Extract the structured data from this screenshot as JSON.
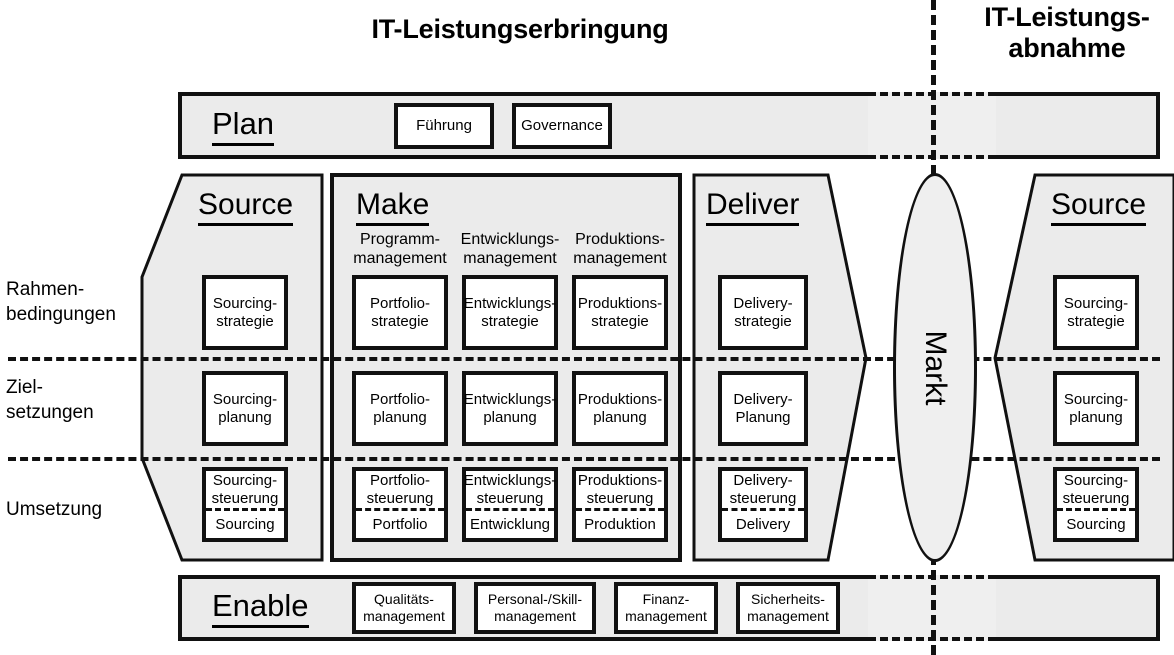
{
  "titles": {
    "left": "IT-Leistungserbringung",
    "right": "IT-Leistungs-\nabnahme"
  },
  "row_labels": [
    "Rahmen-\nbedingungen",
    "Ziel-\nsetzungen",
    "Umsetzung"
  ],
  "plan": {
    "title": "Plan",
    "boxes": [
      "Führung",
      "Governance"
    ]
  },
  "enable": {
    "title": "Enable",
    "boxes": [
      "Qualitäts-\nmanagement",
      "Personal-/Skill-\nmanagement",
      "Finanz-\nmanagement",
      "Sicherheits-\nmanagement"
    ]
  },
  "source_left": {
    "title": "Source",
    "boxes": [
      {
        "top": "Sourcing-\nstrategie",
        "bottom": null
      },
      {
        "top": "Sourcing-\nplanung",
        "bottom": null
      },
      {
        "top": "Sourcing-\nsteuerung",
        "bottom": "Sourcing"
      }
    ]
  },
  "make": {
    "title": "Make",
    "subheads": [
      "Programm-\nmanagement",
      "Entwicklungs-\nmanagement",
      "Produktions-\nmanagement"
    ],
    "columns": [
      {
        "boxes": [
          {
            "top": "Portfolio-\nstrategie",
            "bottom": null
          },
          {
            "top": "Portfolio-\nplanung",
            "bottom": null
          },
          {
            "top": "Portfolio-\nsteuerung",
            "bottom": "Portfolio"
          }
        ]
      },
      {
        "boxes": [
          {
            "top": "Entwicklungs-\nstrategie",
            "bottom": null
          },
          {
            "top": "Entwicklungs-\nplanung",
            "bottom": null
          },
          {
            "top": "Entwicklungs-\nsteuerung",
            "bottom": "Entwicklung"
          }
        ]
      },
      {
        "boxes": [
          {
            "top": "Produktions-\nstrategie",
            "bottom": null
          },
          {
            "top": "Produktions-\nplanung",
            "bottom": null
          },
          {
            "top": "Produktions-\nsteuerung",
            "bottom": "Produktion"
          }
        ]
      }
    ]
  },
  "deliver": {
    "title": "Deliver",
    "boxes": [
      {
        "top": "Delivery-\nstrategie",
        "bottom": null
      },
      {
        "top": "Delivery-\nPlanung",
        "bottom": null
      },
      {
        "top": "Delivery-\nsteuerung",
        "bottom": "Delivery"
      }
    ]
  },
  "source_right": {
    "title": "Source",
    "boxes": [
      {
        "top": "Sourcing-\nstrategie",
        "bottom": null
      },
      {
        "top": "Sourcing-\nplanung",
        "bottom": null
      },
      {
        "top": "Sourcing-\nsteuerung",
        "bottom": "Sourcing"
      }
    ]
  },
  "market": {
    "label": "Markt"
  },
  "colors": {
    "shape_fill": "#ebebeb",
    "ellipse_fill": "#efefef",
    "box_fill": "#ffffff",
    "stroke": "#111111",
    "background": "#ffffff"
  }
}
